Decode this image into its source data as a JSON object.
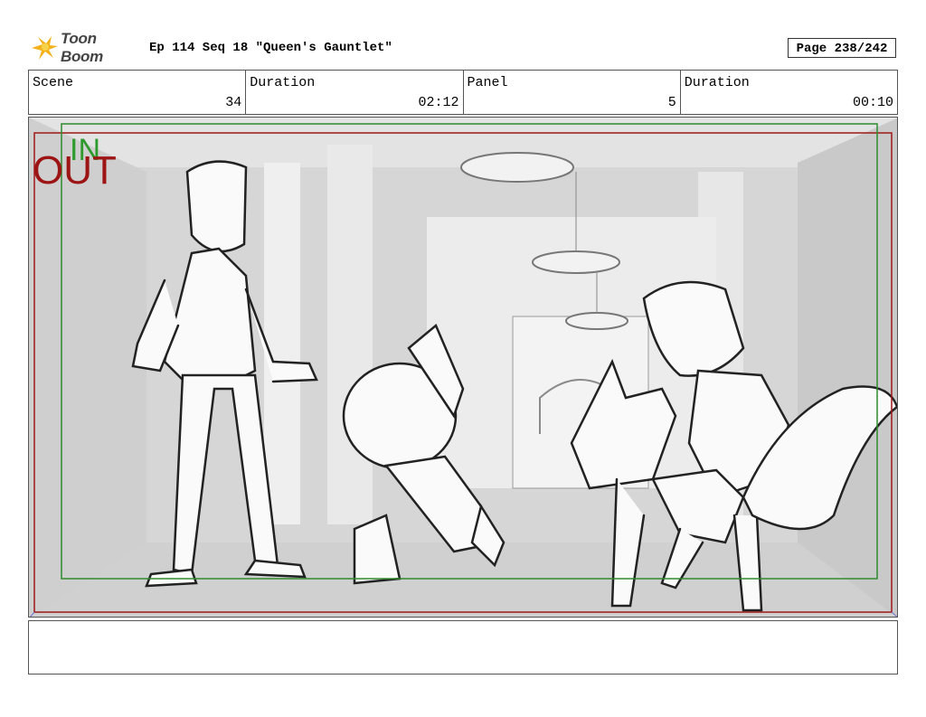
{
  "brand": {
    "logo_text": "Toon Boom"
  },
  "header": {
    "episode_title": "Ep 114 Seq 18 \"Queen's Gauntlet\"",
    "page": "Page 238/242"
  },
  "info": {
    "scene_label": "Scene",
    "scene_value": "34",
    "duration_label": "Duration",
    "duration_value": "02:12",
    "panel_label": "Panel",
    "panel_value": "5",
    "panel_duration_label": "Duration",
    "panel_duration_value": "00:10"
  },
  "frame": {
    "in_label": "IN",
    "out_label": "OUT",
    "in_color": "#2e8b2e",
    "out_color": "#a01818"
  },
  "notes": {
    "text": ""
  }
}
